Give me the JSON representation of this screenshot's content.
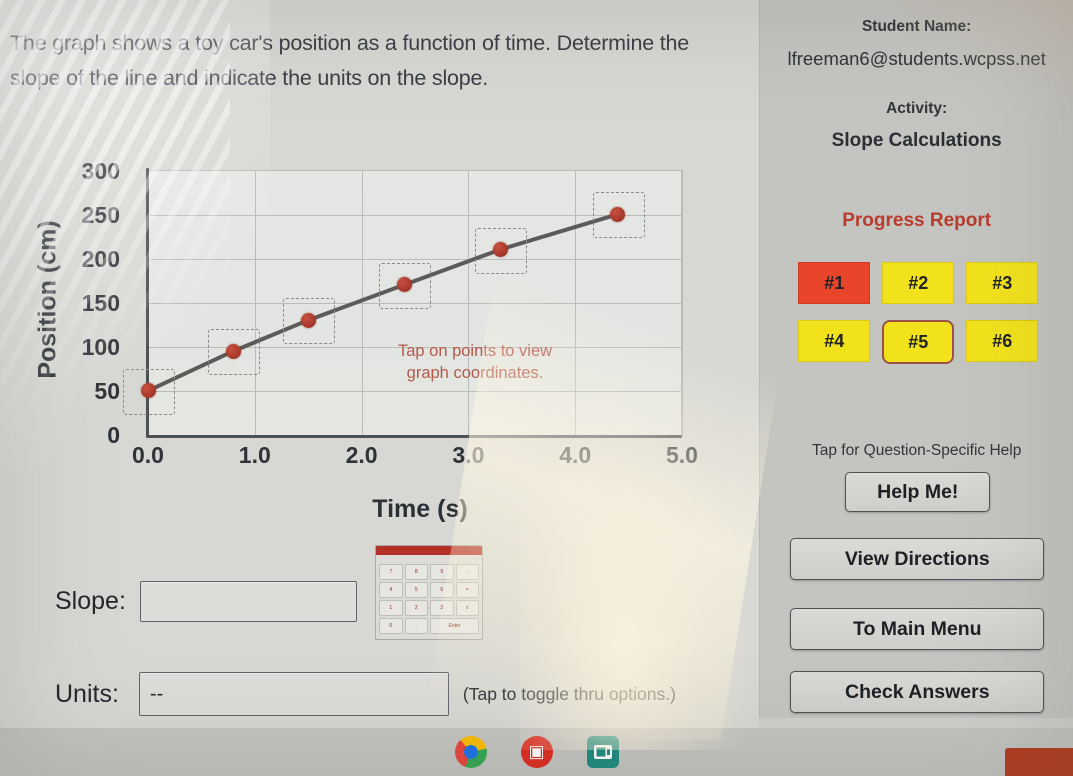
{
  "question": {
    "text": "The graph shows a toy car's position as a function of time. Determine the slope of the line and indicate the units on the slope."
  },
  "graph": {
    "hint_line1": "Tap on points to view",
    "hint_line2": "graph coordinates."
  },
  "chart_data": {
    "type": "line",
    "title": "",
    "xlabel": "Time (s)",
    "ylabel": "Position (cm)",
    "xlim": [
      0.0,
      5.0
    ],
    "ylim": [
      0,
      300
    ],
    "xticks": [
      "0.0",
      "1.0",
      "2.0",
      "3.0",
      "4.0",
      "5.0"
    ],
    "yticks": [
      "0",
      "50",
      "100",
      "150",
      "200",
      "250",
      "300"
    ],
    "grid": true,
    "legend": "none",
    "series": [
      {
        "name": "Position",
        "x": [
          0.0,
          0.8,
          1.5,
          2.4,
          3.3,
          4.4
        ],
        "y": [
          50,
          95,
          130,
          170,
          210,
          250
        ],
        "color": "#a8392c",
        "line_color": "#5d5b59"
      }
    ]
  },
  "form": {
    "slope_label": "Slope:",
    "slope_value": "",
    "units_label": "Units:",
    "units_value": "--",
    "toggle_hint": "(Tap to toggle thru options.)"
  },
  "keypad": {
    "keys": [
      "7",
      "8",
      "9",
      "←",
      "4",
      "5",
      "6",
      "=",
      "1",
      "2",
      "3",
      "x",
      "0",
      ".",
      "Enter"
    ]
  },
  "sidebar": {
    "student_name_label": "Student Name:",
    "student_email": "lfreeman6@students.wcpss.net",
    "activity_label": "Activity:",
    "activity_name": "Slope Calculations",
    "progress_title": "Progress Report",
    "progress_items": [
      {
        "label": "#1",
        "state": "current"
      },
      {
        "label": "#2",
        "state": "pending"
      },
      {
        "label": "#3",
        "state": "pending"
      },
      {
        "label": "#4",
        "state": "pending"
      },
      {
        "label": "#5",
        "state": "pending-selected"
      },
      {
        "label": "#6",
        "state": "pending"
      }
    ],
    "help_hint": "Tap for Question-Specific Help",
    "help_button": "Help Me!",
    "directions_button": "View Directions",
    "main_menu_button": "To Main Menu",
    "check_answers_button": "Check Answers"
  },
  "taskbar": {
    "icons": [
      "chrome-icon",
      "paint-icon",
      "slides-icon"
    ]
  },
  "colors": {
    "accent_red": "#b93b2d",
    "progress_done": "#e8452a",
    "progress_pending": "#f2e21c",
    "point": "#a8392c"
  }
}
